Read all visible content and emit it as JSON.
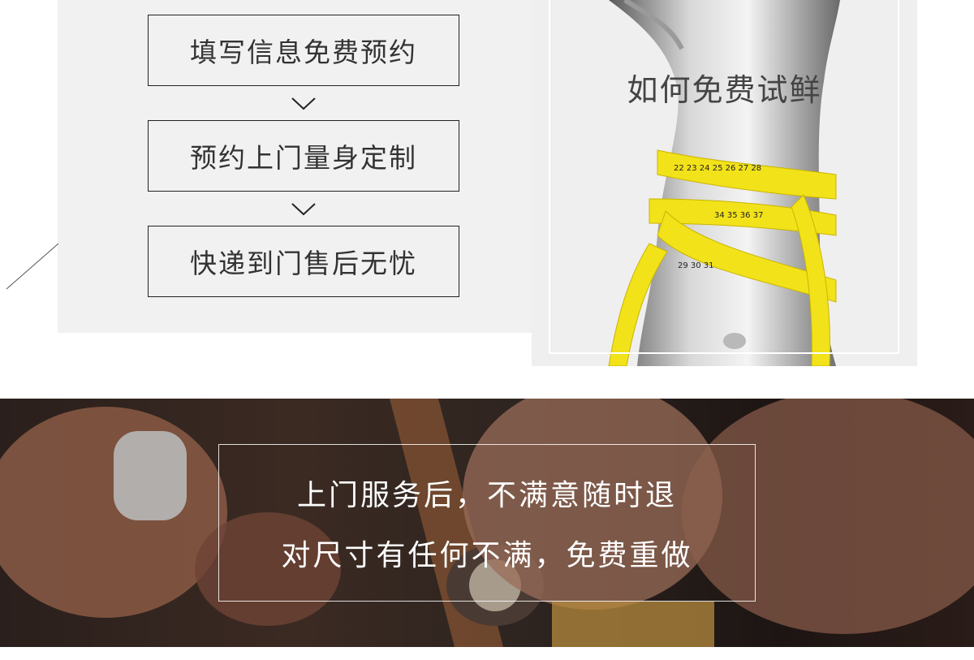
{
  "steps": [
    {
      "label": "填写信息免费预约"
    },
    {
      "label": "预约上门量身定制"
    },
    {
      "label": "快递到门售后无忧"
    }
  ],
  "headline": "如何免费试鲜",
  "promise": {
    "line1": "上门服务后，不满意随时退",
    "line2": "对尺寸有任何不满，免费重做"
  },
  "colors": {
    "panel": "#f1f1f1",
    "tape": "#f2e21a",
    "banner_dark": "#2a1f1c",
    "text": "#333333"
  },
  "icons": [
    "chevron-down-icon",
    "chevron-down-icon"
  ]
}
